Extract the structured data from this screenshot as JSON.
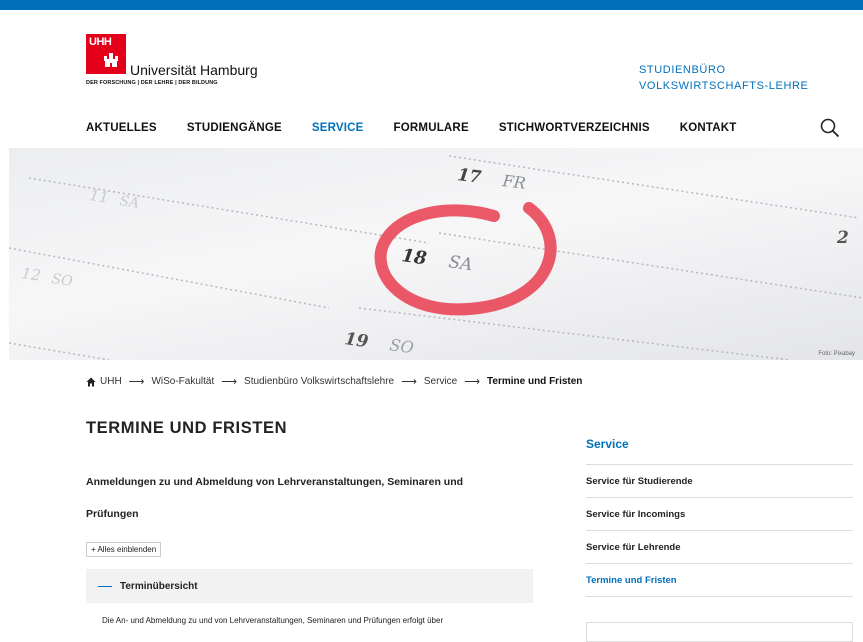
{
  "colors": {
    "accent": "#0271bb",
    "brand_red": "#e2001a",
    "circle": "#e94b5b"
  },
  "logo": {
    "mark": "UHH",
    "name": "Universität Hamburg",
    "tagline": "DER FORSCHUNG | DER LEHRE | DER BILDUNG"
  },
  "institute": "STUDIENBÜRO VOLKSWIRTSCHAFTS-LEHRE",
  "nav": {
    "items": [
      {
        "label": "AKTUELLES"
      },
      {
        "label": "STUDIENGÄNGE"
      },
      {
        "label": "SERVICE",
        "active": true
      },
      {
        "label": "FORMULARE"
      },
      {
        "label": "STICHWORTVERZEICHNIS"
      },
      {
        "label": "KONTAKT"
      }
    ],
    "search_icon": "search-icon"
  },
  "hero": {
    "dates": [
      "11",
      "SA",
      "12",
      "SO",
      "17",
      "FR",
      "18",
      "SA",
      "19",
      "SO",
      "2"
    ],
    "credit": "Foto: Pixabay"
  },
  "breadcrumb": {
    "home_icon": "home-icon",
    "items": [
      "UHH",
      "WiSo-Fakultät",
      "Studienbüro Volkswirtschaftslehre",
      "Service",
      "Termine und Fristen"
    ],
    "separator": "⟶"
  },
  "main": {
    "title": "TERMINE UND FRISTEN",
    "lead": "Anmeldungen zu und Abmeldung von Lehrveranstaltungen, Seminaren und Prüfungen",
    "expand_all": "+ Alles einblenden",
    "accordion": {
      "label": "Terminübersicht",
      "text": "Die An- und Abmeldung zu und von Lehrveranstaltungen, Seminaren und Prüfungen erfolgt über"
    }
  },
  "sidebar": {
    "heading": "Service",
    "items": [
      {
        "label": "Service für Studierende"
      },
      {
        "label": "Service für Incomings"
      },
      {
        "label": "Service für Lehrende"
      },
      {
        "label": "Termine und Fristen",
        "active": true
      }
    ]
  }
}
